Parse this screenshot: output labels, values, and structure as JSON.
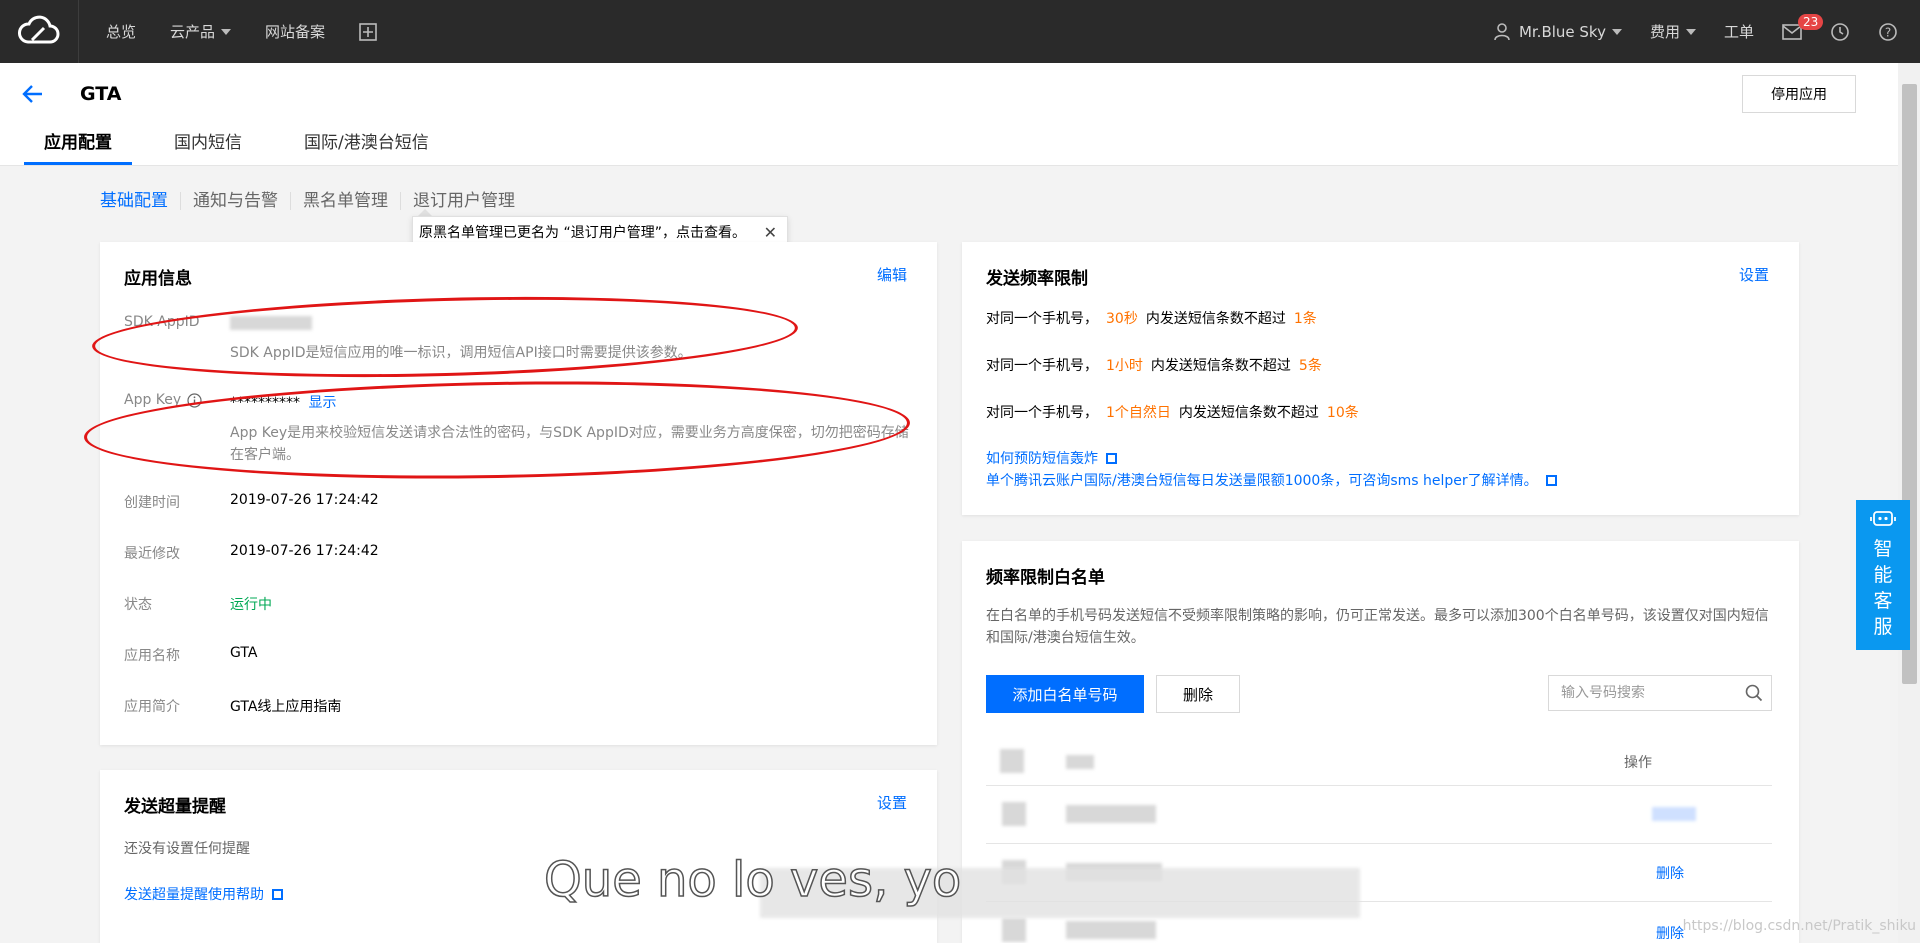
{
  "topbar": {
    "nav": [
      "总览",
      "云产品",
      "网站备案"
    ],
    "user": "Mr.Blue Sky",
    "fees": "费用",
    "ticket": "工单",
    "mail_badge": "23"
  },
  "header": {
    "app_name": "GTA",
    "disable_button": "停用应用",
    "tabs": [
      "应用配置",
      "国内短信",
      "国际/港澳台短信"
    ]
  },
  "subtabs": [
    "基础配置",
    "通知与告警",
    "黑名单管理",
    "退订用户管理"
  ],
  "tooltip": "原黑名单管理已更名为 “退订用户管理”，点击查看。",
  "app_info": {
    "title": "应用信息",
    "edit": "编辑",
    "sdk_label": "SDK AppID",
    "sdk_desc": "SDK AppID是短信应用的唯一标识，调用短信API接口时需要提供该参数。",
    "appkey_label": "App Key",
    "appkey_value": "**********",
    "appkey_show": "显示",
    "appkey_desc": "App Key是用来校验短信发送请求合法性的密码，与SDK AppID对应，需要业务方高度保密，切勿把密码存储在客户端。",
    "created_label": "创建时间",
    "created_value": "2019-07-26 17:24:42",
    "modified_label": "最近修改",
    "modified_value": "2019-07-26 17:24:42",
    "status_label": "状态",
    "status_value": "运行中",
    "name_label": "应用名称",
    "name_value": "GTA",
    "intro_label": "应用简介",
    "intro_value": "GTA线上应用指南"
  },
  "overflow": {
    "title": "发送超量提醒",
    "settings": "设置",
    "empty": "还没有设置任何提醒",
    "help": "发送超量提醒使用帮助"
  },
  "rate_limit": {
    "title": "发送频率限制",
    "settings": "设置",
    "prefix": "对同一个手机号，",
    "mid": "内发送短信条数不超过",
    "rows": [
      {
        "period": "30秒",
        "count": "1条"
      },
      {
        "period": "1小时",
        "count": "5条"
      },
      {
        "period": "1个自然日",
        "count": "10条"
      }
    ],
    "link1": "如何预防短信轰炸",
    "link2": "单个腾讯云账户国际/港澳台短信每日发送量限额1000条，可咨询sms helper了解详情。"
  },
  "whitelist": {
    "title": "频率限制白名单",
    "desc": "在白名单的手机号码发送短信不受频率限制策略的影响，仍可正常发送。最多可以添加300个白名单号码，该设置仅对国内短信和国际/港澳台短信生效。",
    "add_button": "添加白名单号码",
    "delete_button": "删除",
    "search_placeholder": "输入号码搜索",
    "col_op": "操作",
    "row_op": "删除"
  },
  "side_widget": [
    "智",
    "能",
    "客",
    "服"
  ],
  "subtitle": "Que no lo ves, yo",
  "watermark": "https://blog.csdn.net/Pratik_shiku",
  "colors": {
    "accent": "#006eff",
    "orange": "#ff7200",
    "green": "#00a854",
    "topbar": "#2a2a2a"
  }
}
